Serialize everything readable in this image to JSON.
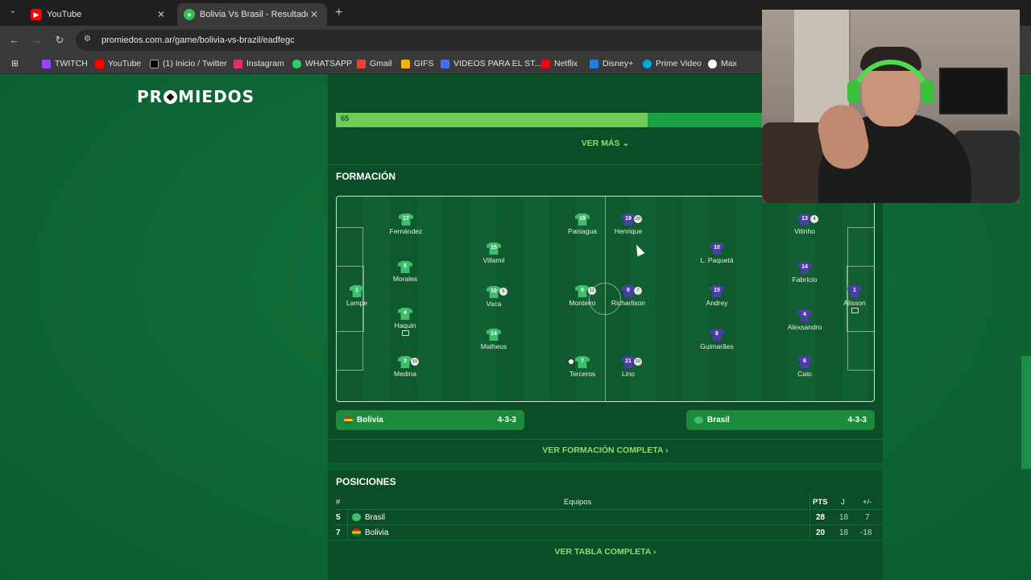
{
  "browser": {
    "tabs": [
      {
        "title": "YouTube",
        "favicon": "youtube-icon",
        "active": false
      },
      {
        "title": "Bolivia Vs Brasil - Resultado en",
        "favicon": "promiedos-icon",
        "active": true
      }
    ],
    "url": "promiedos.com.ar/game/bolivia-vs-brazil/eadfegc",
    "bookmarks": [
      {
        "label": "TWITCH",
        "color": "#9146ff"
      },
      {
        "label": "YouTube",
        "color": "#ff0000"
      },
      {
        "label": "(1) Inicio / Twitter",
        "color": "#000000"
      },
      {
        "label": "Instagram",
        "color": "#e1306c"
      },
      {
        "label": "WHATSAPP",
        "color": "#25d366"
      },
      {
        "label": "Gmail",
        "color": "#ea4335"
      },
      {
        "label": "GIFS",
        "color": "#f4b400"
      },
      {
        "label": "VIDEOS PARA EL ST...",
        "color": "#4a6cf7"
      },
      {
        "label": "Netflix",
        "color": "#e50914"
      },
      {
        "label": "Disney+",
        "color": "#1f80e0"
      },
      {
        "label": "Prime Video",
        "color": "#00a8e1"
      },
      {
        "label": "Max",
        "color": "#ffffff"
      }
    ]
  },
  "site": {
    "logo": "PROMIEDOS"
  },
  "stats": {
    "bar_value": "65",
    "bar_fraction": 0.58,
    "ver_mas": "VER MÁS ⌄"
  },
  "formation": {
    "title": "FORMACIÓN",
    "bolivia": {
      "name": "Bolivia",
      "formation": "4-3-3",
      "flag_color": "#f2c30f",
      "players": [
        {
          "name": "Lampe",
          "number": "1"
        },
        {
          "name": "Fernández",
          "number": "17"
        },
        {
          "name": "Morales",
          "number": "5"
        },
        {
          "name": "Haquin",
          "number": "4",
          "card": true
        },
        {
          "name": "Medina",
          "number": "3",
          "badge": "⑩"
        },
        {
          "name": "Villamil",
          "number": "15"
        },
        {
          "name": "Vaca",
          "number": "10",
          "badge": "6"
        },
        {
          "name": "Matheus",
          "number": "14"
        },
        {
          "name": "Paniagua",
          "number": "19"
        },
        {
          "name": "Monteiro",
          "number": "9",
          "badge": "11"
        },
        {
          "name": "Terceros",
          "number": "7",
          "ball": true
        }
      ]
    },
    "brasil": {
      "name": "Brasil",
      "formation": "4-3-3",
      "flag_color": "#3fbf6e",
      "players": [
        {
          "name": "Henrique",
          "number": "19",
          "badge": "20"
        },
        {
          "name": "Richarlison",
          "number": "9",
          "badge": "7"
        },
        {
          "name": "Lino",
          "number": "21",
          "badge": "10"
        },
        {
          "name": "L. Paquetá",
          "number": "10"
        },
        {
          "name": "Andrey",
          "number": "15"
        },
        {
          "name": "Guimarães",
          "number": "8"
        },
        {
          "name": "Vitinho",
          "number": "13",
          "badge": "4"
        },
        {
          "name": "Fabrício",
          "number": "14"
        },
        {
          "name": "Alexsandro",
          "number": "4"
        },
        {
          "name": "Caio",
          "number": "6"
        },
        {
          "name": "Alisson",
          "number": "1",
          "card": true
        }
      ]
    },
    "ver_completa": "VER FORMACIÓN COMPLETA ›"
  },
  "positions": {
    "title": "POSICIONES",
    "headers": {
      "rank": "#",
      "team": "Equipos",
      "pts": "PTS",
      "played": "J",
      "diff": "+/-"
    },
    "rows": [
      {
        "rank": "5",
        "team": "Brasil",
        "pts": "28",
        "played": "18",
        "diff": "7",
        "flag_color": "#3fbf6e"
      },
      {
        "rank": "7",
        "team": "Bolivia",
        "pts": "20",
        "played": "18",
        "diff": "-18",
        "flag_color": "#f2c30f"
      }
    ],
    "ver_tabla": "VER TABLA COMPLETA ›"
  }
}
